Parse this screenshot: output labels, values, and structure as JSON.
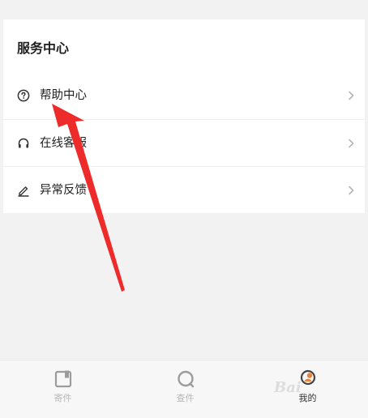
{
  "section": {
    "title": "服务中心"
  },
  "menu": {
    "items": [
      {
        "label": "帮助中心",
        "icon": "question-circle-icon"
      },
      {
        "label": "在线客服",
        "icon": "headset-icon"
      },
      {
        "label": "异常反馈",
        "icon": "pencil-icon"
      }
    ]
  },
  "tabbar": {
    "tabs": [
      {
        "label": "寄件",
        "icon": "send-package-icon",
        "active": false
      },
      {
        "label": "查件",
        "icon": "search-package-icon",
        "active": false
      },
      {
        "label": "我的",
        "icon": "profile-icon",
        "active": true
      }
    ]
  },
  "annotation": {
    "arrow_color": "#ee2b2b"
  },
  "watermark": {
    "text": "Bai"
  }
}
